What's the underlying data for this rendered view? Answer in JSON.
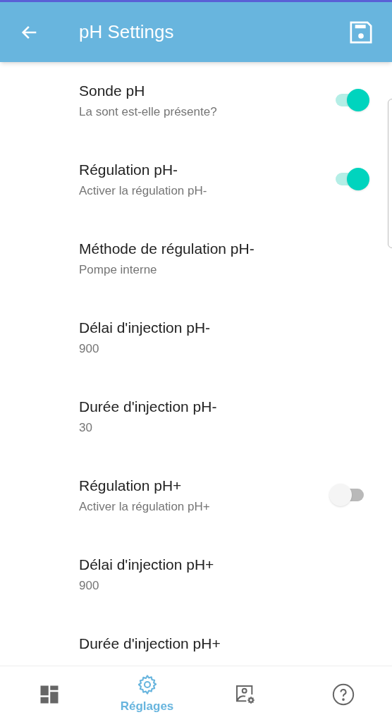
{
  "app_bar": {
    "title": "pH Settings"
  },
  "settings": [
    {
      "kind": "switch",
      "title": "Sonde pH",
      "subtitle": "La sont est-elle présente?",
      "on": true
    },
    {
      "kind": "switch",
      "title": "Régulation pH-",
      "subtitle": "Activer la régulation pH-",
      "on": true
    },
    {
      "kind": "value",
      "title": "Méthode de régulation pH-",
      "subtitle": "Pompe interne"
    },
    {
      "kind": "value",
      "title": "Délai d'injection pH-",
      "subtitle": "900"
    },
    {
      "kind": "value",
      "title": "Durée d'injection pH-",
      "subtitle": "30"
    },
    {
      "kind": "switch",
      "title": "Régulation pH+",
      "subtitle": "Activer la régulation pH+",
      "on": false
    },
    {
      "kind": "value",
      "title": "Délai d'injection pH+",
      "subtitle": "900"
    },
    {
      "kind": "value",
      "title": "Durée d'injection pH+"
    }
  ],
  "bottom_nav": [
    {
      "selected": false
    },
    {
      "selected": true,
      "label": "Réglages"
    },
    {
      "selected": false
    },
    {
      "selected": false
    }
  ]
}
